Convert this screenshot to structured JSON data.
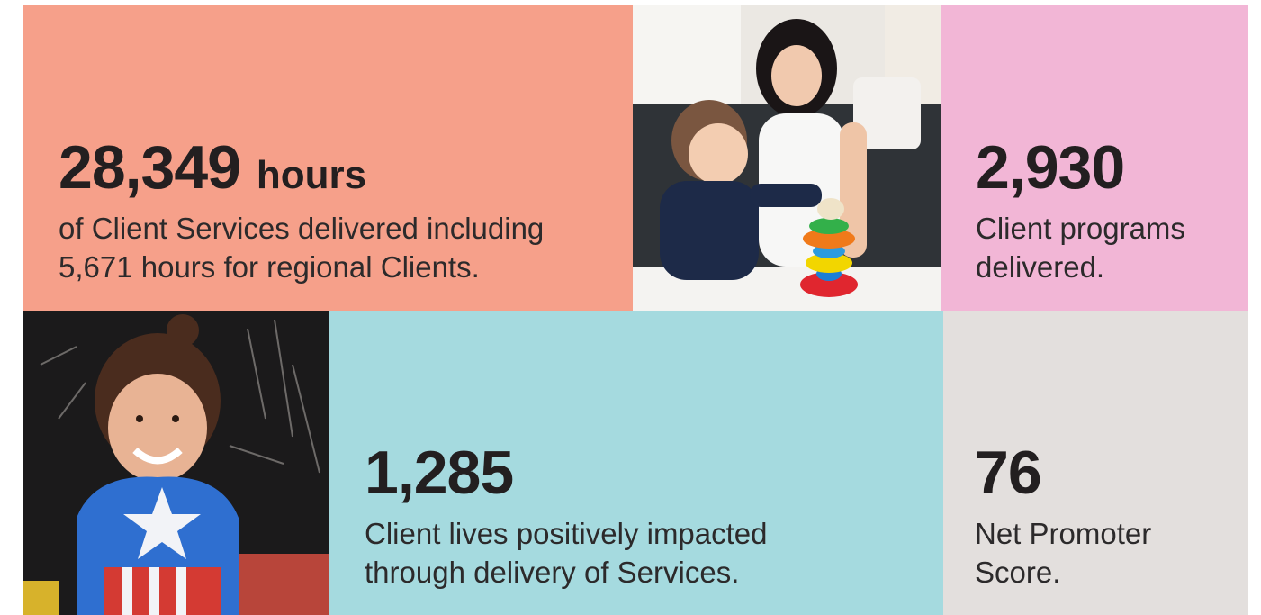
{
  "stats": [
    {
      "number": "28,349",
      "unit": "hours",
      "line1": "of Client Services delivered including",
      "line2": "5,671 hours for regional Clients."
    },
    {
      "number": "2,930",
      "line1": "Client programs",
      "line2": "delivered."
    },
    {
      "number": "1,285",
      "line1": "Client lives positively impacted",
      "line2": "through delivery of Services."
    },
    {
      "number": "76",
      "line1": "Net Promoter",
      "line2": "Score."
    }
  ],
  "photos": {
    "top": "photo-mother-and-toddler-stacking-rings",
    "bottom": "photo-child-in-superhero-costume"
  },
  "colors": {
    "salmon": "#f6a08a",
    "pink": "#f2b6d6",
    "teal": "#a5dadf",
    "grey": "#e3dfdd",
    "text": "#231f20"
  }
}
